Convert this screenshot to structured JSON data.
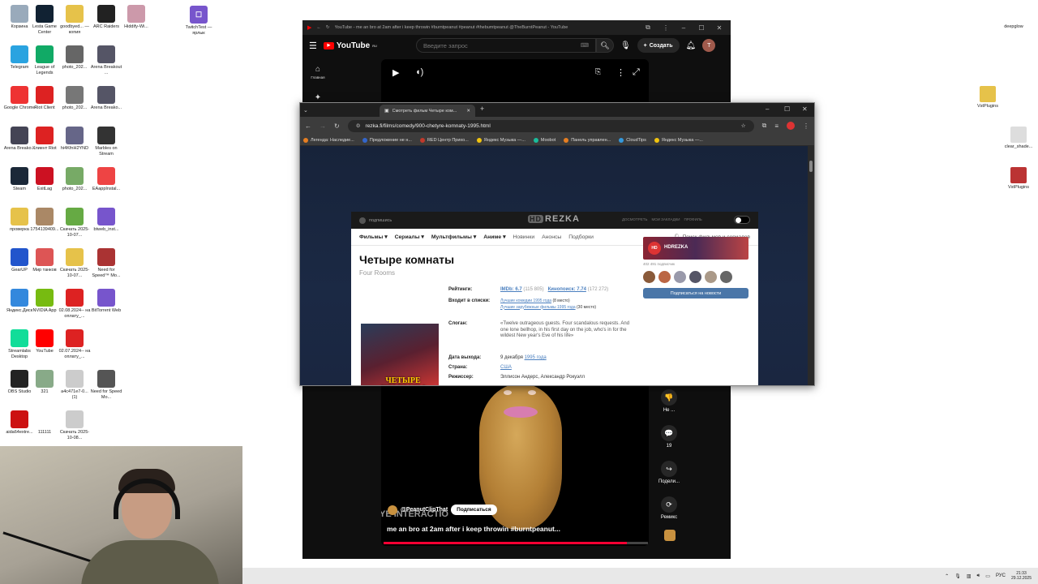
{
  "desktop": {
    "icons": [
      {
        "label": "Корзина",
        "color": "#9ab"
      },
      {
        "label": "Lesta Game Center",
        "color": "#123"
      },
      {
        "label": "goodbyed... — копия",
        "color": "#e6c24a"
      },
      {
        "label": "ARC Raiders",
        "color": "#222"
      },
      {
        "label": "Hiddify-Wi...",
        "color": "#c9a"
      },
      {
        "label": "Telegram",
        "color": "#2aa3e0"
      },
      {
        "label": "League of Legends",
        "color": "#1a6"
      },
      {
        "label": "photo_202...",
        "color": "#666"
      },
      {
        "label": "Arena Breakout ...",
        "color": "#556"
      },
      {
        "label": "Google Chrome",
        "color": "#e33"
      },
      {
        "label": "Riot Client",
        "color": "#d22"
      },
      {
        "label": "photo_202...",
        "color": "#777"
      },
      {
        "label": "Arena Breako...",
        "color": "#556"
      },
      {
        "label": "Arena Breako...",
        "color": "#445"
      },
      {
        "label": "Клиент Riot",
        "color": "#d22"
      },
      {
        "label": "hi4KfnH2YND",
        "color": "#668"
      },
      {
        "label": "Marbles on Stream",
        "color": "#333"
      },
      {
        "label": "Steam",
        "color": "#1b2838"
      },
      {
        "label": "ExitLag",
        "color": "#c12"
      },
      {
        "label": "photo_202...",
        "color": "#7a6"
      },
      {
        "label": "EAappInstal...",
        "color": "#e44"
      },
      {
        "label": "проверка",
        "color": "#e6c24a"
      },
      {
        "label": "1754139409...",
        "color": "#a86"
      },
      {
        "label": "Скачать 2025-10-07...",
        "color": "#6a4"
      },
      {
        "label": "btweb_inst...",
        "color": "#75c"
      },
      {
        "label": "GearUP",
        "color": "#25c"
      },
      {
        "label": "Мир танков",
        "color": "#d55"
      },
      {
        "label": "Скачать 2025-10-07...",
        "color": "#e6c24a"
      },
      {
        "label": "Need for Speed™ Mo...",
        "color": "#a33"
      },
      {
        "label": "Яндекс.Диск",
        "color": "#38d"
      },
      {
        "label": "NVIDIA App",
        "color": "#7b1"
      },
      {
        "label": "02.08.2024-- на оплату_...",
        "color": "#d22"
      },
      {
        "label": "BitTorrent Web",
        "color": "#75c"
      },
      {
        "label": "Streamlabs Desktop",
        "color": "#1d9"
      },
      {
        "label": "YouTube",
        "color": "#f00"
      },
      {
        "label": "02.07.2024-- на оплату_...",
        "color": "#d22"
      },
      {
        "label": "OBS Studio",
        "color": "#222"
      },
      {
        "label": "321",
        "color": "#8a8"
      },
      {
        "label": "a4c471e7-0... (1)",
        "color": "#ccc"
      },
      {
        "label": "Need for Speed Mo...",
        "color": "#555"
      },
      {
        "label": "aida64extre...",
        "color": "#c11"
      },
      {
        "label": "111111",
        "color": "#fff"
      },
      {
        "label": "Скачать 2025-10-08...",
        "color": "#ccc"
      }
    ],
    "top_right": [
      {
        "label": "deepglow",
        "color": "#fff"
      },
      {
        "label": "VstPlugins",
        "color": "#e6c24a"
      },
      {
        "label": "clear_shade...",
        "color": "#ddd"
      },
      {
        "label": "VstPlugins",
        "color": "#b33"
      }
    ],
    "twitch_label": "TwitchTest — ярлык"
  },
  "youtube": {
    "window_title": "YouTube - me an bro at 2am after i keep throwin #burntpeanut #peanut #thebumtpeanut @TheBurntPeanut - YouTube",
    "logo_text": "YouTube",
    "logo_sup": "RU",
    "search_placeholder": "Введите запрос",
    "create_label": "Создать",
    "avatar_letter": "T",
    "sidebar_home": "Главная",
    "channel_handle": "@PeanutClipThat",
    "subscribe_label": "Подписаться",
    "caption": "me an bro at 2am after i keep throwin #burntpeanut...",
    "overlay_text": "YE INTERACTIO",
    "progress_percent": 92,
    "actions": [
      {
        "icon": "👎",
        "label": "Не ..."
      },
      {
        "icon": "💬",
        "label": "19"
      },
      {
        "icon": "↪",
        "label": "Подели..."
      },
      {
        "icon": "⟳",
        "label": "Ремикс"
      }
    ]
  },
  "browser": {
    "tab_title": "Смотреть фильм Четыре ком...",
    "url": "rezka.fi/films/comedy/900-chetyre-komnaty-1995.html",
    "bookmarks": [
      {
        "label": "Легенда: Наследие...",
        "color": "#e67e22"
      },
      {
        "label": "Предложение не н...",
        "color": "#3366cc"
      },
      {
        "label": "RED Центр Прихо...",
        "color": "#c0392b"
      },
      {
        "label": "Яндекс Музыка —...",
        "color": "#f1c40f"
      },
      {
        "label": "Moobot",
        "color": "#1abc9c"
      },
      {
        "label": "Панель управлен...",
        "color": "#e67e22"
      },
      {
        "label": "CloudTips",
        "color": "#3498db"
      },
      {
        "label": "Яндекс Музыка —...",
        "color": "#f1c40f"
      }
    ]
  },
  "rezka": {
    "head_left": "подпишись",
    "logo": "REZKA",
    "logo_hd": "HD",
    "head_links": [
      "ДОСМОТРЕТЬ",
      "МОИ ЗАКЛАДКИ",
      "ПРОФИЛЬ"
    ],
    "nav": [
      {
        "label": "Фильмы ▾",
        "bold": true
      },
      {
        "label": "Сериалы ▾",
        "bold": true
      },
      {
        "label": "Мультфильмы ▾",
        "bold": true
      },
      {
        "label": "Аниме ▾",
        "bold": true
      },
      {
        "label": "Новинки",
        "bold": false
      },
      {
        "label": "Анонсы",
        "bold": false
      },
      {
        "label": "Подборки",
        "bold": false
      }
    ],
    "search_placeholder": "Поиск фильмов и сериалов",
    "title": "Четыре комнаты",
    "original_title": "Four Rooms",
    "poster_text": "ЧЕТЫРЕ КОМНАТЫ",
    "info": {
      "ratings_label": "Рейтинги:",
      "imdb": "IMDb: 6.7",
      "imdb_votes": "(115 805)",
      "kp": "Кинопоиск: 7.74",
      "kp_votes": "(172 272)",
      "lists_label": "Входит в списки:",
      "list1": "Лучшие комедии 1995 года",
      "list1_place": "(8 место)",
      "list2": "Лучшие зарубежные фильмы 1995 года",
      "list2_place": "(30 место)",
      "slogan_label": "Слоган:",
      "slogan": "«Twelve outrageous guests. Four scandalous requests. And one lone bellhop, in his first day on the job, who's in for the wildest New year's Eve of his life»",
      "release_label": "Дата выхода:",
      "release": "9 декабря",
      "release_year": "1995 года",
      "country_label": "Страна:",
      "country": "США",
      "director_label": "Режиссер:",
      "director": "Эллисон Андерс, Александр Рокуэлл"
    },
    "side": {
      "channel": "HDREZKA",
      "subs": "402 491 подписчик",
      "vk_button": "Подписаться на новости"
    }
  },
  "taskbar": {
    "lang": "РУС",
    "time": "21:33",
    "date": "29.12.2025"
  }
}
